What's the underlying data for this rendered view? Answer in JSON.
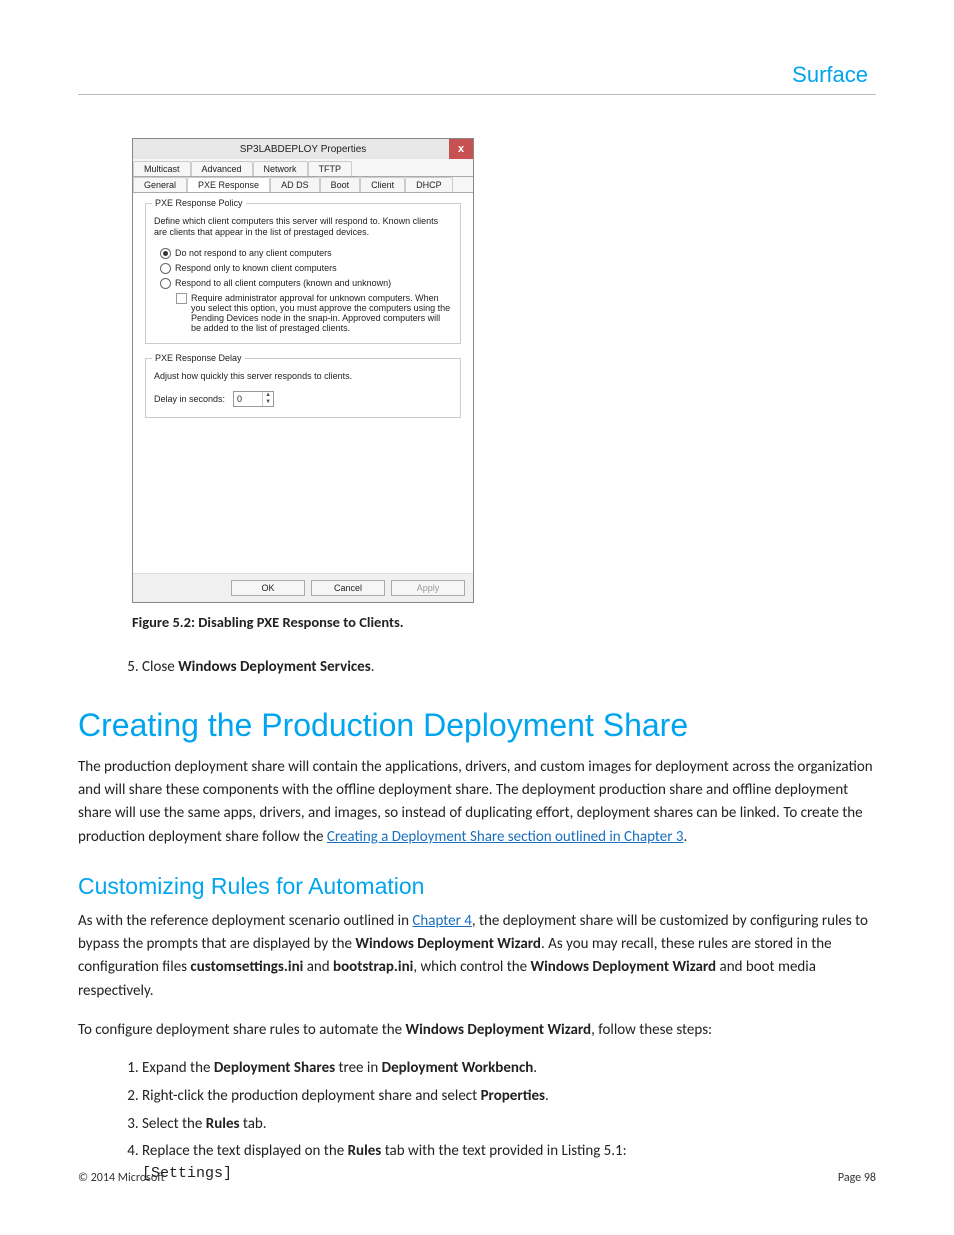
{
  "brand": "Surface",
  "dialog": {
    "title": "SP3LABDEPLOY Properties",
    "close": "x",
    "tabs_row1": [
      "Multicast",
      "Advanced",
      "Network",
      "TFTP"
    ],
    "tabs_row2": [
      "General",
      "PXE Response",
      "AD DS",
      "Boot",
      "Client",
      "DHCP"
    ],
    "active_tab": "PXE Response",
    "policy_legend": "PXE Response Policy",
    "policy_desc": "Define which client computers this server will respond to. Known clients are clients that appear in the list of prestaged devices.",
    "options": {
      "opt1": "Do not respond to any client computers",
      "opt2": "Respond only to known client computers",
      "opt3": "Respond to all client computers (known and unknown)"
    },
    "checkbox_text": "Require administrator approval for unknown computers. When you select this option, you must approve the computers using the Pending Devices node in the snap-in. Approved computers will be added to the list of prestaged clients.",
    "delay_legend": "PXE Response Delay",
    "delay_desc": "Adjust how quickly this server responds to clients.",
    "delay_label": "Delay in seconds:",
    "delay_value": "0",
    "buttons": {
      "ok": "OK",
      "cancel": "Cancel",
      "apply": "Apply"
    }
  },
  "figcap": "Figure 5.2: Disabling PXE Response to Clients.",
  "step5_pre": "Close ",
  "step5_bold": "Windows Deployment Services",
  "step5_post": ".",
  "h1": "Creating the Production Deployment Share",
  "para1_pre": "The production deployment share will contain the applications, drivers, and custom images for deployment across the organization and will share these components with the offline deployment share. The deployment production share and offline deployment share will use the same apps, drivers, and images, so instead of duplicating effort, deployment shares can be linked. To create the production deployment share follow the ",
  "para1_link": "Creating a Deployment Share section outlined in Chapter 3",
  "para1_post": ".",
  "h2": "Customizing Rules for Automation",
  "para2_a": "As with the reference deployment scenario outlined in ",
  "para2_link": "Chapter 4",
  "para2_b": ", the deployment share will be customized by configuring rules to bypass the prompts that are displayed by the ",
  "para2_bold1": "Windows Deployment Wizard",
  "para2_c": ". As you may recall, these rules are stored in the configuration files ",
  "para2_bold2": "customsettings.ini",
  "para2_d": " and ",
  "para2_bold3": "bootstrap.ini",
  "para2_e": ", which control the ",
  "para2_bold4": "Windows Deployment Wizard",
  "para2_f": " and boot media respectively.",
  "para3_pre": "To configure deployment share rules to automate the ",
  "para3_bold": "Windows Deployment Wizard",
  "para3_post": ", follow these steps:",
  "steps": {
    "s1_a": "Expand the ",
    "s1_b": "Deployment Shares",
    "s1_c": " tree in ",
    "s1_d": "Deployment Workbench",
    "s1_e": ".",
    "s2_a": "Right-click the production deployment share and select ",
    "s2_b": "Properties",
    "s2_c": ".",
    "s3_a": "Select the ",
    "s3_b": "Rules",
    "s3_c": " tab.",
    "s4_a": "Replace the text displayed on the ",
    "s4_b": "Rules",
    "s4_c": " tab with the text provided in Listing 5.1:",
    "s4_code": "[Settings]"
  },
  "footer_left": "© 2014 Microsoft",
  "footer_right": "Page 98"
}
